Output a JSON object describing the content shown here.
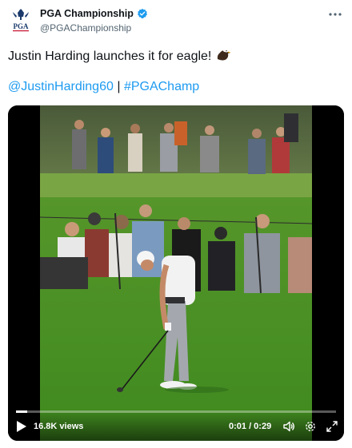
{
  "account": {
    "display_name": "PGA Championship",
    "handle": "@PGAChampionship",
    "logo_text": "PGA",
    "verified": true
  },
  "tweet": {
    "text": "Justin Harding launches it for eagle!",
    "emoji": "eagle-emoji",
    "mention": "@JustinHarding60",
    "separator": "|",
    "hashtag": "#PGAChamp"
  },
  "video": {
    "views": "16.8K views",
    "time": "0:01 / 0:29",
    "progress": 0.034
  },
  "colors": {
    "link": "#1d9bf0",
    "verified": "#1d9bf0",
    "text": "#0f1419",
    "muted": "#536471"
  },
  "icons": [
    "more-icon",
    "verified-badge-icon",
    "play-icon",
    "volume-icon",
    "settings-icon",
    "fullscreen-icon"
  ]
}
